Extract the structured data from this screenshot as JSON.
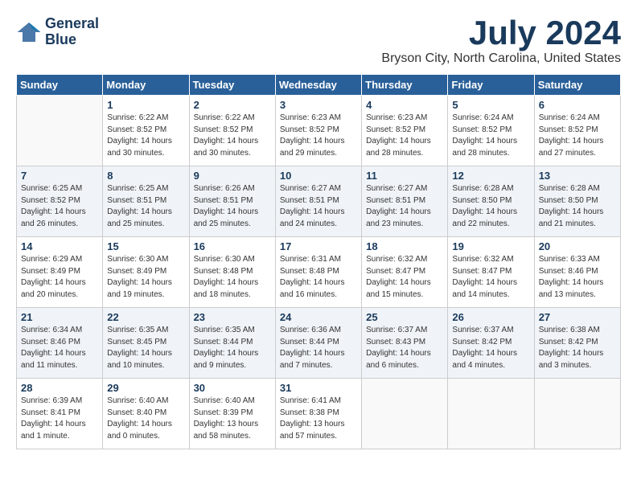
{
  "header": {
    "logo_line1": "General",
    "logo_line2": "Blue",
    "month": "July 2024",
    "location": "Bryson City, North Carolina, United States"
  },
  "days_of_week": [
    "Sunday",
    "Monday",
    "Tuesday",
    "Wednesday",
    "Thursday",
    "Friday",
    "Saturday"
  ],
  "weeks": [
    [
      {
        "day": "",
        "content": ""
      },
      {
        "day": "1",
        "content": "Sunrise: 6:22 AM\nSunset: 8:52 PM\nDaylight: 14 hours and 30 minutes."
      },
      {
        "day": "2",
        "content": "Sunrise: 6:22 AM\nSunset: 8:52 PM\nDaylight: 14 hours and 30 minutes."
      },
      {
        "day": "3",
        "content": "Sunrise: 6:23 AM\nSunset: 8:52 PM\nDaylight: 14 hours and 29 minutes."
      },
      {
        "day": "4",
        "content": "Sunrise: 6:23 AM\nSunset: 8:52 PM\nDaylight: 14 hours and 28 minutes."
      },
      {
        "day": "5",
        "content": "Sunrise: 6:24 AM\nSunset: 8:52 PM\nDaylight: 14 hours and 28 minutes."
      },
      {
        "day": "6",
        "content": "Sunrise: 6:24 AM\nSunset: 8:52 PM\nDaylight: 14 hours and 27 minutes."
      }
    ],
    [
      {
        "day": "7",
        "content": "Sunrise: 6:25 AM\nSunset: 8:52 PM\nDaylight: 14 hours and 26 minutes."
      },
      {
        "day": "8",
        "content": "Sunrise: 6:25 AM\nSunset: 8:51 PM\nDaylight: 14 hours and 25 minutes."
      },
      {
        "day": "9",
        "content": "Sunrise: 6:26 AM\nSunset: 8:51 PM\nDaylight: 14 hours and 25 minutes."
      },
      {
        "day": "10",
        "content": "Sunrise: 6:27 AM\nSunset: 8:51 PM\nDaylight: 14 hours and 24 minutes."
      },
      {
        "day": "11",
        "content": "Sunrise: 6:27 AM\nSunset: 8:51 PM\nDaylight: 14 hours and 23 minutes."
      },
      {
        "day": "12",
        "content": "Sunrise: 6:28 AM\nSunset: 8:50 PM\nDaylight: 14 hours and 22 minutes."
      },
      {
        "day": "13",
        "content": "Sunrise: 6:28 AM\nSunset: 8:50 PM\nDaylight: 14 hours and 21 minutes."
      }
    ],
    [
      {
        "day": "14",
        "content": "Sunrise: 6:29 AM\nSunset: 8:49 PM\nDaylight: 14 hours and 20 minutes."
      },
      {
        "day": "15",
        "content": "Sunrise: 6:30 AM\nSunset: 8:49 PM\nDaylight: 14 hours and 19 minutes."
      },
      {
        "day": "16",
        "content": "Sunrise: 6:30 AM\nSunset: 8:48 PM\nDaylight: 14 hours and 18 minutes."
      },
      {
        "day": "17",
        "content": "Sunrise: 6:31 AM\nSunset: 8:48 PM\nDaylight: 14 hours and 16 minutes."
      },
      {
        "day": "18",
        "content": "Sunrise: 6:32 AM\nSunset: 8:47 PM\nDaylight: 14 hours and 15 minutes."
      },
      {
        "day": "19",
        "content": "Sunrise: 6:32 AM\nSunset: 8:47 PM\nDaylight: 14 hours and 14 minutes."
      },
      {
        "day": "20",
        "content": "Sunrise: 6:33 AM\nSunset: 8:46 PM\nDaylight: 14 hours and 13 minutes."
      }
    ],
    [
      {
        "day": "21",
        "content": "Sunrise: 6:34 AM\nSunset: 8:46 PM\nDaylight: 14 hours and 11 minutes."
      },
      {
        "day": "22",
        "content": "Sunrise: 6:35 AM\nSunset: 8:45 PM\nDaylight: 14 hours and 10 minutes."
      },
      {
        "day": "23",
        "content": "Sunrise: 6:35 AM\nSunset: 8:44 PM\nDaylight: 14 hours and 9 minutes."
      },
      {
        "day": "24",
        "content": "Sunrise: 6:36 AM\nSunset: 8:44 PM\nDaylight: 14 hours and 7 minutes."
      },
      {
        "day": "25",
        "content": "Sunrise: 6:37 AM\nSunset: 8:43 PM\nDaylight: 14 hours and 6 minutes."
      },
      {
        "day": "26",
        "content": "Sunrise: 6:37 AM\nSunset: 8:42 PM\nDaylight: 14 hours and 4 minutes."
      },
      {
        "day": "27",
        "content": "Sunrise: 6:38 AM\nSunset: 8:42 PM\nDaylight: 14 hours and 3 minutes."
      }
    ],
    [
      {
        "day": "28",
        "content": "Sunrise: 6:39 AM\nSunset: 8:41 PM\nDaylight: 14 hours and 1 minute."
      },
      {
        "day": "29",
        "content": "Sunrise: 6:40 AM\nSunset: 8:40 PM\nDaylight: 14 hours and 0 minutes."
      },
      {
        "day": "30",
        "content": "Sunrise: 6:40 AM\nSunset: 8:39 PM\nDaylight: 13 hours and 58 minutes."
      },
      {
        "day": "31",
        "content": "Sunrise: 6:41 AM\nSunset: 8:38 PM\nDaylight: 13 hours and 57 minutes."
      },
      {
        "day": "",
        "content": ""
      },
      {
        "day": "",
        "content": ""
      },
      {
        "day": "",
        "content": ""
      }
    ]
  ]
}
